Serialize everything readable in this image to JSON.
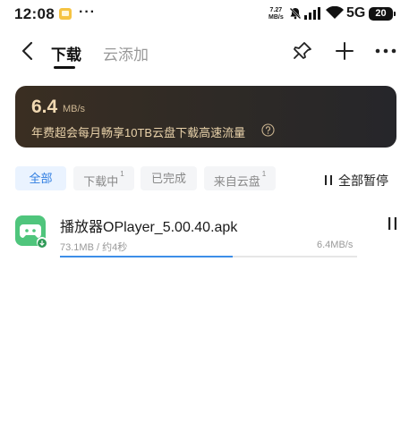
{
  "status_bar": {
    "time": "12:08",
    "more": "···",
    "net_speed_value": "7.27",
    "net_speed_unit": "MB/s",
    "network": "5G",
    "battery": "20"
  },
  "header": {
    "tab_active": "下载",
    "tab_inactive": "云添加"
  },
  "banner": {
    "speed_value": "6.4",
    "speed_unit": "MB/s",
    "promo_text": "年费超会每月畅享10TB云盘下载高速流量"
  },
  "filters": [
    {
      "label": "全部",
      "count": ""
    },
    {
      "label": "下载中",
      "count": "1"
    },
    {
      "label": "已完成",
      "count": ""
    },
    {
      "label": "来自云盘",
      "count": "1"
    }
  ],
  "pause_all_label": "全部暂停",
  "download": {
    "file_name": "播放器OPlayer_5.00.40.apk",
    "size_time": "73.1MB / 约4秒",
    "speed": "6.4MB/s",
    "progress_percent": 58
  },
  "colors": {
    "accent": "#2f7de1",
    "progress": "#3d8ee8",
    "banner_text": "#e9d2aa",
    "app_icon": "#4fc57c"
  }
}
